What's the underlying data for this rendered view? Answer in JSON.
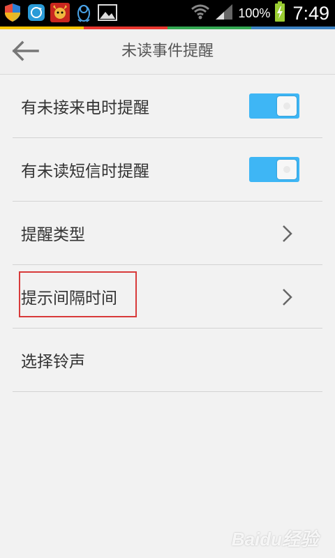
{
  "status_bar": {
    "battery_text": "100%",
    "time": "7:49",
    "icons": [
      "shield-icon",
      "sync-icon",
      "app-mascot-icon",
      "qq-penguin-icon",
      "gallery-icon"
    ],
    "stripe_colors": [
      "#f6c400",
      "#e9362f",
      "#33a852",
      "#3b82c4"
    ]
  },
  "header": {
    "title": "未读事件提醒",
    "back_icon": "arrow-left-icon"
  },
  "settings": [
    {
      "label": "有未接来电时提醒",
      "control": "toggle",
      "on": true
    },
    {
      "label": "有未读短信时提醒",
      "control": "toggle",
      "on": true
    },
    {
      "label": "提醒类型",
      "control": "chevron"
    },
    {
      "label": "提示间隔时间",
      "control": "chevron",
      "highlighted": true
    },
    {
      "label": "选择铃声",
      "control": "none"
    }
  ],
  "colors": {
    "toggle_on": "#3eb6f5",
    "highlight": "#d83a3a",
    "background": "#f2f2f2"
  },
  "watermark": "Baidu经验"
}
